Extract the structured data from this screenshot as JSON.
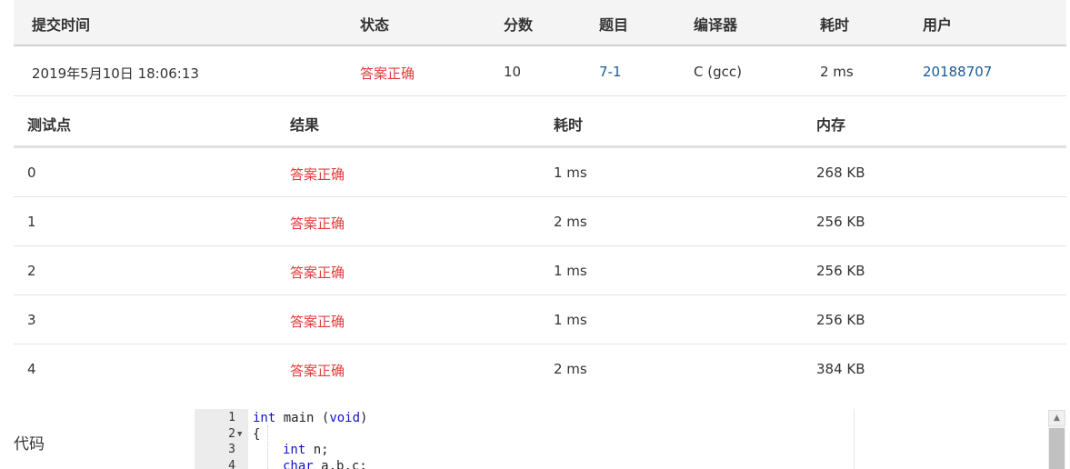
{
  "submission": {
    "headers": [
      "提交时间",
      "状态",
      "分数",
      "题目",
      "编译器",
      "耗时",
      "用户"
    ],
    "time": "2019年5月10日 18:06:13",
    "status": "答案正确",
    "score": "10",
    "problem": "7-1",
    "compiler": "C (gcc)",
    "elapsed": "2 ms",
    "user": "20188707"
  },
  "tests": {
    "headers": [
      "测试点",
      "结果",
      "耗时",
      "内存"
    ],
    "rows": [
      {
        "id": "0",
        "result": "答案正确",
        "time": "1 ms",
        "memory": "268 KB"
      },
      {
        "id": "1",
        "result": "答案正确",
        "time": "2 ms",
        "memory": "256 KB"
      },
      {
        "id": "2",
        "result": "答案正确",
        "time": "1 ms",
        "memory": "256 KB"
      },
      {
        "id": "3",
        "result": "答案正确",
        "time": "1 ms",
        "memory": "256 KB"
      },
      {
        "id": "4",
        "result": "答案正确",
        "time": "2 ms",
        "memory": "384 KB"
      }
    ]
  },
  "code": {
    "label": "代码",
    "line_numbers": [
      "1",
      "2",
      "3",
      "4"
    ],
    "lines": {
      "l1_kw1": "int",
      "l1_rest": " main (",
      "l1_kw2": "void",
      "l1_end": ")",
      "l2": "{",
      "l3_kw": "int",
      "l3_rest": " n;",
      "l4_kw": "char",
      "l4_rest": " a,b,c;"
    }
  },
  "colors": {
    "accent_red": "#e23c3c",
    "link_blue": "#1a5a96",
    "keyword_blue": "#1212c8"
  }
}
